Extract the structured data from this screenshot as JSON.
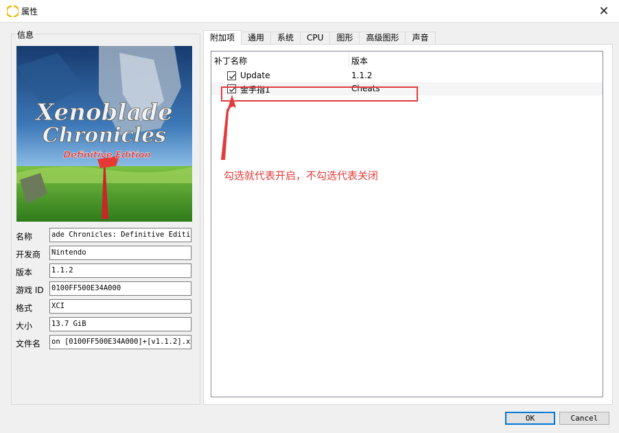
{
  "window": {
    "title": "属性",
    "close_glyph": "✕"
  },
  "info": {
    "group_title": "信息",
    "cover": {
      "title_line1": "Xenoblade",
      "title_line2": "Chronicles",
      "subtitle": "Definitive Edition"
    },
    "fields": [
      {
        "label": "名称",
        "value": "ade Chronicles: Definitive Edition"
      },
      {
        "label": "开发商",
        "value": "Nintendo"
      },
      {
        "label": "版本",
        "value": "1.1.2"
      },
      {
        "label": "游戏 ID",
        "value": "0100FF500E34A000"
      },
      {
        "label": "格式",
        "value": "XCI"
      },
      {
        "label": "大小",
        "value": "13.7 GiB"
      },
      {
        "label": "文件名",
        "value": "on [0100FF500E34A000]+[v1.1.2].xci"
      }
    ]
  },
  "tabs": [
    {
      "label": "附加项",
      "active": true
    },
    {
      "label": "通用",
      "active": false
    },
    {
      "label": "系统",
      "active": false
    },
    {
      "label": "CPU",
      "active": false
    },
    {
      "label": "图形",
      "active": false
    },
    {
      "label": "高级图形",
      "active": false
    },
    {
      "label": "声音",
      "active": false
    }
  ],
  "addons": {
    "columns": {
      "name": "补丁名称",
      "version": "版本"
    },
    "rows": [
      {
        "name": "Update",
        "version": "1.1.2",
        "checked": true
      },
      {
        "name": "金手指1",
        "version": "Cheats",
        "checked": true
      }
    ]
  },
  "annotation": {
    "text": "勾选就代表开启，不勾选代表关闭",
    "color": "#e33b3b"
  },
  "buttons": {
    "ok": "OK",
    "cancel": "Cancel"
  },
  "colors": {
    "accent": "#0078d7",
    "annotation": "#e33b3b",
    "window_bg": "#f0f0f0"
  },
  "icons": {
    "app": "yuzu-logo-icon",
    "close": "close-icon",
    "checkbox": "checkmark-icon"
  }
}
